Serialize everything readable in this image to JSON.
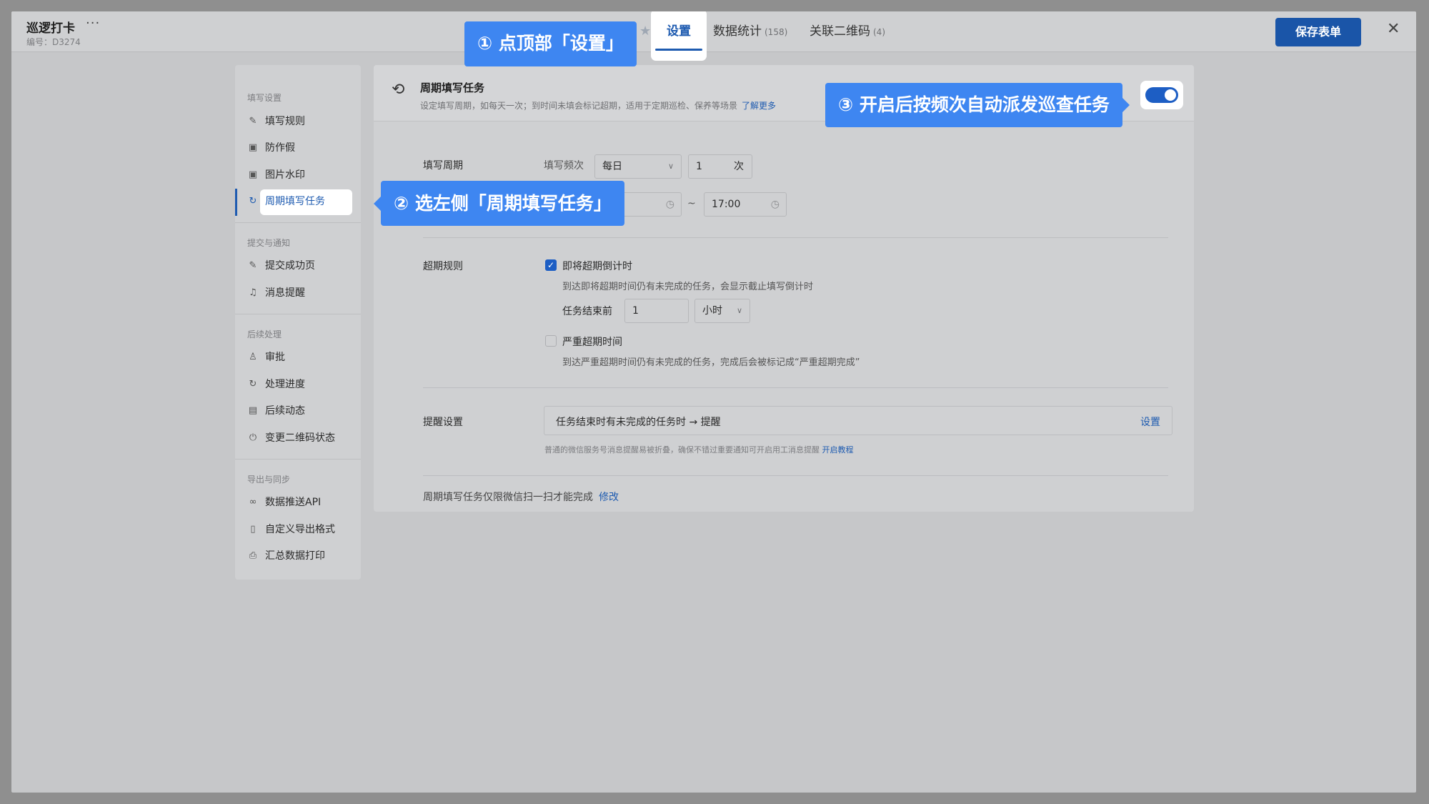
{
  "header": {
    "app_title": "巡逻打卡",
    "more_icon": "···",
    "app_code": "编号：D3274",
    "tabs": [
      {
        "label": "设置",
        "count": ""
      },
      {
        "label": "数据统计",
        "count": "(158)"
      },
      {
        "label": "关联二维码",
        "count": "(4)"
      }
    ],
    "save_label": "保存表单",
    "close_icon": "✕"
  },
  "sidebar": {
    "groups": [
      {
        "title": "填写设置",
        "items": [
          {
            "label": "填写规则",
            "icon": "edit-icon"
          },
          {
            "label": "防作假",
            "icon": "image-icon"
          },
          {
            "label": "图片水印",
            "icon": "watermark-icon"
          },
          {
            "label": "周期填写任务",
            "icon": "cycle-icon",
            "active": true
          }
        ]
      },
      {
        "title": "提交与通知",
        "items": [
          {
            "label": "提交成功页",
            "icon": "edit-icon"
          },
          {
            "label": "消息提醒",
            "icon": "bell-icon"
          }
        ]
      },
      {
        "title": "后续处理",
        "items": [
          {
            "label": "审批",
            "icon": "stamp-icon"
          },
          {
            "label": "处理进度",
            "icon": "cycle-icon"
          },
          {
            "label": "后续动态",
            "icon": "doc-icon"
          },
          {
            "label": "变更二维码状态",
            "icon": "power-icon"
          }
        ]
      },
      {
        "title": "导出与同步",
        "items": [
          {
            "label": "数据推送API",
            "icon": "link-icon"
          },
          {
            "label": "自定义导出格式",
            "icon": "file-icon"
          },
          {
            "label": "汇总数据打印",
            "icon": "printer-icon"
          }
        ]
      }
    ]
  },
  "panel": {
    "title": "周期填写任务",
    "desc": "设定填写周期，如每天一次；到时间未填会标记超期，适用于定期巡检、保养等场景",
    "learn_more": "了解更多",
    "toggle_on": true,
    "cycle": {
      "label": "填写周期",
      "freq_label": "填写频次",
      "freq_value": "每日",
      "times_value": "1",
      "times_unit": "次",
      "end_time": "17:00",
      "tilde": "~"
    },
    "overdue": {
      "label": "超期规则",
      "countdown_label": "即将超期倒计时",
      "countdown_checked": true,
      "countdown_hint": "到达即将超期时间仍有未完成的任务，会显示截止填写倒计时",
      "before_end_label": "任务结束前",
      "before_end_value": "1",
      "before_end_unit": "小时",
      "severe_label": "严重超期时间",
      "severe_checked": false,
      "severe_hint": "到达严重超期时间仍有未完成的任务，完成后会被标记成“严重超期完成”"
    },
    "reminder": {
      "label": "提醒设置",
      "rule_text": "任务结束时有未完成的任务时 → 提醒",
      "set_label": "设置",
      "note": "普通的微信服务号消息提醒易被折叠，确保不错过重要通知可开启用工消息提醒",
      "note_link": "开启教程"
    },
    "footer": {
      "text": "周期填写任务仅限微信扫一扫才能完成",
      "link": "修改"
    }
  },
  "callouts": {
    "step1": "① 点顶部「设置」",
    "step2": "② 选左侧「周期填写任务」",
    "step3": "③ 开启后按频次自动派发巡查任务"
  },
  "colors": {
    "accent": "#1e5bb0",
    "callout": "#3e86f1",
    "toggle_on": "#1d5ec4",
    "save_button": "#1a55a8"
  }
}
